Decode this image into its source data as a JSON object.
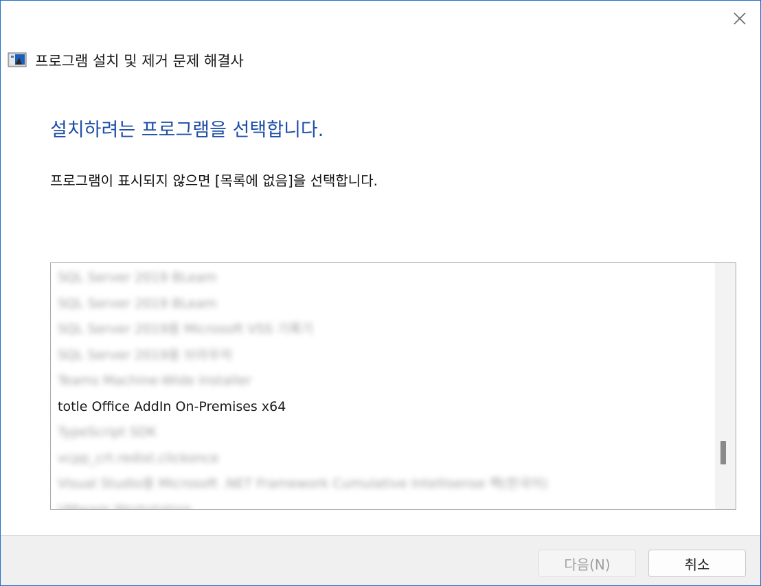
{
  "window": {
    "title": "프로그램 설치 및 제거 문제 해결사",
    "close_glyph": "✕"
  },
  "main": {
    "heading": "설치하려는 프로그램을 선택합니다.",
    "instruction": "프로그램이 표시되지 않으면 [목록에 없음]을 선택합니다."
  },
  "program_list": {
    "items": [
      {
        "label": "SQL Server 2019 BLeam",
        "blurred": true
      },
      {
        "label": "SQL Server 2019 BLeam",
        "blurred": true
      },
      {
        "label": "SQL Server 2019용 Microsoft VSS 기록기",
        "blurred": true
      },
      {
        "label": "SQL Server 2019용 브라우저",
        "blurred": true
      },
      {
        "label": "Teams Machine-Wide Installer",
        "blurred": true
      },
      {
        "label": "totle Office AddIn On-Premises x64",
        "blurred": false
      },
      {
        "label": "TypeScript SDK",
        "blurred": true
      },
      {
        "label": "vcpp_crt.redist.clickonce",
        "blurred": true
      },
      {
        "label": "Visual Studio용 Microsoft .NET Framework Cumulative Intellisense 팩(한국어)",
        "blurred": true
      },
      {
        "label": "VMware Workstation",
        "blurred": true
      }
    ],
    "scroll_position": 0.72
  },
  "footer": {
    "next_label": "다음(N)",
    "cancel_label": "취소"
  }
}
